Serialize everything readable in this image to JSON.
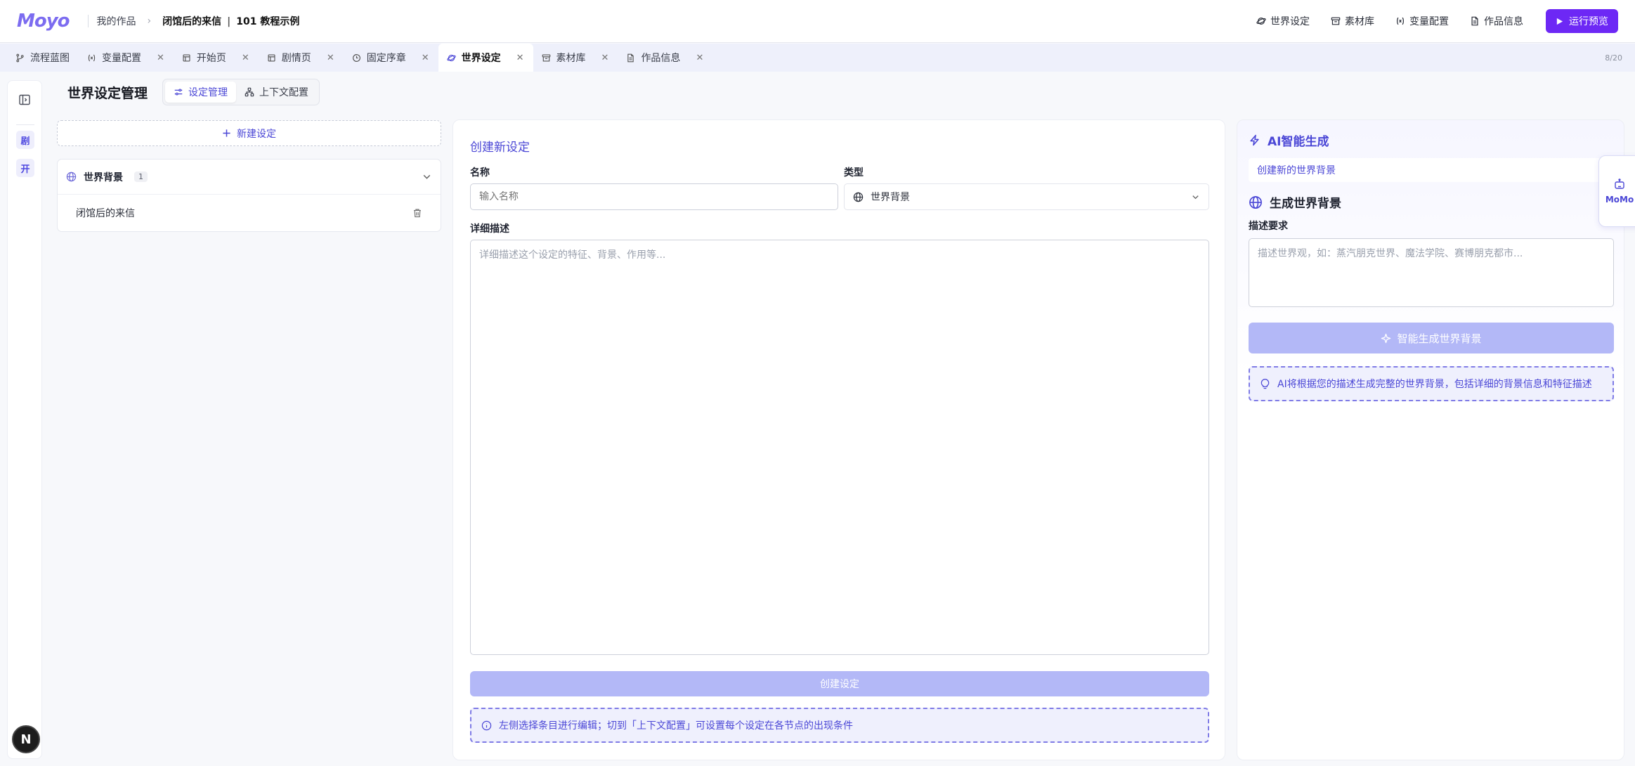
{
  "app": {
    "logo": "Moyo"
  },
  "breadcrumb": {
    "root": "我的作品",
    "separator": "›",
    "project": "闭馆后的来信",
    "divider": "|",
    "subtitle": "101 教程示例"
  },
  "topnav": {
    "items": [
      {
        "label": "世界设定",
        "icon": "planet-icon"
      },
      {
        "label": "素材库",
        "icon": "archive-icon"
      },
      {
        "label": "变量配置",
        "icon": "variable-icon"
      },
      {
        "label": "作品信息",
        "icon": "document-icon"
      }
    ],
    "run_label": "运行预览"
  },
  "tabs": {
    "items": [
      {
        "label": "流程蓝图",
        "closable": false
      },
      {
        "label": "变量配置",
        "closable": true
      },
      {
        "label": "开始页",
        "closable": true
      },
      {
        "label": "剧情页",
        "closable": true
      },
      {
        "label": "固定序章",
        "closable": true
      },
      {
        "label": "世界设定",
        "closable": true,
        "active": true
      },
      {
        "label": "素材库",
        "closable": true
      },
      {
        "label": "作品信息",
        "closable": true
      }
    ],
    "close_glyph": "✕",
    "count": "8/20"
  },
  "rail": {
    "chip_1": "剧",
    "chip_2": "开",
    "bottom_badge": "N"
  },
  "page": {
    "title": "世界设定管理",
    "segments": {
      "manage": "设定管理",
      "context": "上下文配置"
    }
  },
  "list": {
    "new_label": "新建设定",
    "group": {
      "title": "世界背景",
      "count": "1",
      "items": [
        "闭馆后的来信"
      ]
    }
  },
  "form": {
    "title": "创建新设定",
    "name_label": "名称",
    "name_placeholder": "输入名称",
    "type_label": "类型",
    "type_value": "世界背景",
    "desc_label": "详细描述",
    "desc_placeholder": "详细描述这个设定的特征、背景、作用等...",
    "submit_label": "创建设定",
    "hint": "左侧选择条目进行编辑；切到「上下文配置」可设置每个设定在各节点的出现条件"
  },
  "ai": {
    "title": "AI智能生成",
    "subtitle": "创建新的世界背景",
    "gen_title": "生成世界背景",
    "req_label": "描述要求",
    "req_placeholder": "描述世界观，如：蒸汽朋克世界、魔法学院、赛博朋克都市...",
    "gen_button": "智能生成世界背景",
    "hint": "AI将根据您的描述生成完整的世界背景，包括详细的背景信息和特征描述"
  },
  "momo": {
    "label": "MoMo"
  },
  "colors": {
    "accent": "#4b47d6",
    "primary_button": "#6d28f5",
    "disabled_button": "#b3b8f7"
  }
}
